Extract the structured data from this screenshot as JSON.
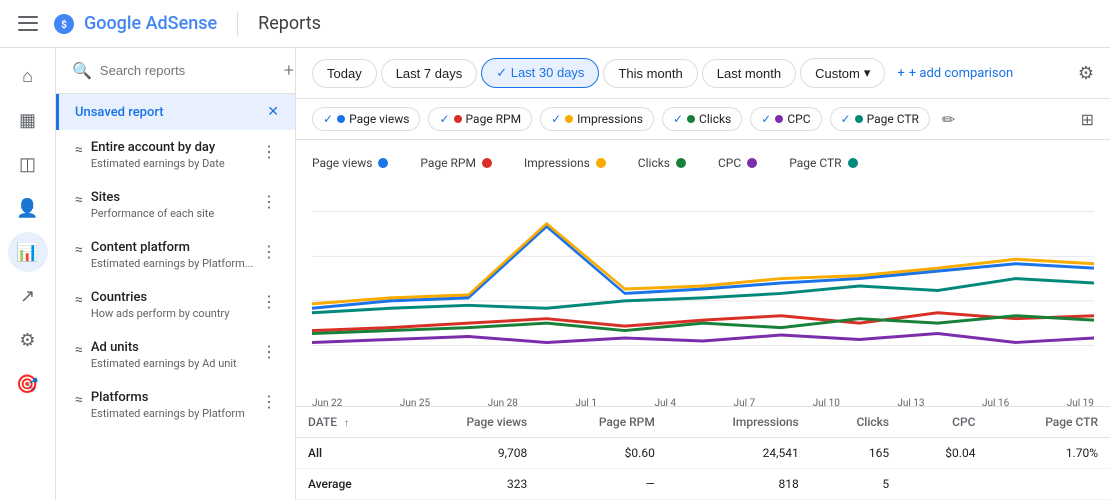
{
  "header": {
    "menu_icon": "☰",
    "logo_text": "Google AdSense",
    "divider": true,
    "title": "Reports"
  },
  "sidebar_icons": [
    {
      "name": "home-icon",
      "icon": "⌂",
      "active": false
    },
    {
      "name": "overview-icon",
      "icon": "▦",
      "active": false
    },
    {
      "name": "block-icon",
      "icon": "◫",
      "active": false
    },
    {
      "name": "person-icon",
      "icon": "👤",
      "active": false
    },
    {
      "name": "reports-icon",
      "icon": "📊",
      "active": true
    },
    {
      "name": "trends-icon",
      "icon": "↗",
      "active": false
    },
    {
      "name": "settings-icon",
      "icon": "⚙",
      "active": false
    },
    {
      "name": "optimize-icon",
      "icon": "🎯",
      "active": false
    }
  ],
  "left_panel": {
    "search_placeholder": "Search reports",
    "add_label": "+",
    "unsaved_label": "Unsaved report",
    "close_label": "✕",
    "reports": [
      {
        "title": "Entire account by day",
        "subtitle": "Estimated earnings by Date",
        "icon": "≈"
      },
      {
        "title": "Sites",
        "subtitle": "Performance of each site",
        "icon": "≈"
      },
      {
        "title": "Content platform",
        "subtitle": "Estimated earnings by Platform...",
        "icon": "≈"
      },
      {
        "title": "Countries",
        "subtitle": "How ads perform by country",
        "icon": "≈"
      },
      {
        "title": "Ad units",
        "subtitle": "Estimated earnings by Ad unit",
        "icon": "≈"
      },
      {
        "title": "Platforms",
        "subtitle": "Estimated earnings by Platform",
        "icon": "≈"
      }
    ]
  },
  "date_filter": {
    "buttons": [
      "Today",
      "Last 7 days",
      "Last 30 days",
      "This month",
      "Last month"
    ],
    "active_index": 2,
    "custom_label": "Custom",
    "add_comparison_label": "+ add comparison",
    "settings_icon": "⚙"
  },
  "metric_chips": [
    {
      "label": "Page views",
      "color": "#1a73e8"
    },
    {
      "label": "Page RPM",
      "color": "#d93025"
    },
    {
      "label": "Impressions",
      "color": "#f9ab00"
    },
    {
      "label": "Clicks",
      "color": "#188038"
    },
    {
      "label": "CPC",
      "color": "#7b2dab"
    },
    {
      "label": "Page CTR",
      "color": "#00897b"
    }
  ],
  "chart": {
    "x_labels": [
      "Jun 22",
      "Jun 25",
      "Jun 28",
      "Jul 1",
      "Jul 4",
      "Jul 7",
      "Jul 10",
      "Jul 13",
      "Jul 16",
      "Jul 19"
    ],
    "colors": {
      "page_views": "#1a73e8",
      "page_rpm": "#d93025",
      "impressions": "#f9ab00",
      "clicks": "#188038",
      "cpc": "#7b2dab",
      "page_ctr": "#00897b"
    }
  },
  "table": {
    "columns": [
      "DATE",
      "Page views",
      "Page RPM",
      "Impressions",
      "Clicks",
      "CPC",
      "Page CTR"
    ],
    "rows": [
      {
        "date": "All",
        "page_views": "9,708",
        "page_rpm": "$0.60",
        "impressions": "24,541",
        "clicks": "165",
        "cpc": "$0.04",
        "page_ctr": "1.70%"
      },
      {
        "date": "Average",
        "page_views": "323",
        "page_rpm": "—",
        "impressions": "818",
        "clicks": "5",
        "cpc": "",
        "page_ctr": ""
      }
    ]
  }
}
